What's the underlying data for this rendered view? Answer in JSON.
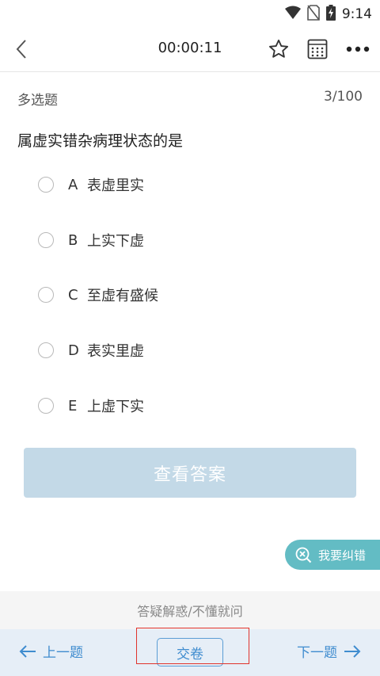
{
  "status": {
    "time": "9:14"
  },
  "toolbar": {
    "timer": "00:00:11"
  },
  "question": {
    "type": "多选题",
    "progress": "3/100",
    "stem": "属虚实错杂病理状态的是",
    "options": [
      {
        "letter": "A",
        "text": "表虚里实"
      },
      {
        "letter": "B",
        "text": "上实下虚"
      },
      {
        "letter": "C",
        "text": "至虚有盛候"
      },
      {
        "letter": "D",
        "text": "表实里虚"
      },
      {
        "letter": "E",
        "text": "上虚下实"
      }
    ]
  },
  "actions": {
    "view_answer": "查看答案",
    "correction": "我要纠错",
    "ask": "答疑解惑/不懂就问"
  },
  "nav": {
    "prev": "上一题",
    "submit": "交卷",
    "next": "下一题"
  },
  "colors": {
    "accent": "#3f8ccf",
    "answer_button": "#c3d9e7",
    "correction_bg": "#63bcc4",
    "bottom_nav_bg": "#e6eef7",
    "highlight": "#e0332c"
  }
}
